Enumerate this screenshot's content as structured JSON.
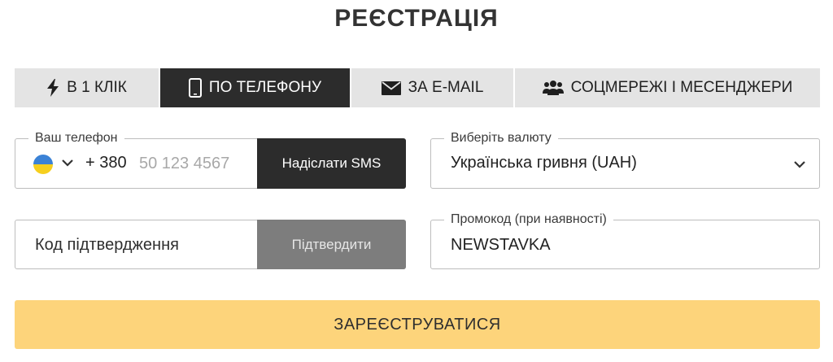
{
  "page": {
    "title": "РЕЄСТРАЦІЯ"
  },
  "tabs": [
    {
      "label": "В 1 КЛІК",
      "icon": "lightning-icon",
      "active": false
    },
    {
      "label": "ПО ТЕЛЕФОНУ",
      "icon": "smartphone-icon",
      "active": true
    },
    {
      "label": "ЗА E-MAIL",
      "icon": "envelope-icon",
      "active": false
    },
    {
      "label": "СОЦМЕРЕЖІ І МЕСЕНДЖЕРИ",
      "icon": "users-icon",
      "active": false
    }
  ],
  "phone": {
    "label": "Ваш телефон",
    "country_flag": "ukraine-flag-icon",
    "prefix": "+ 380",
    "value": "",
    "placeholder": "50 123 4567",
    "send_button": "Надіслати SMS"
  },
  "currency": {
    "label": "Виберіть валюту",
    "selected": "Українська гривня (UAH)"
  },
  "code": {
    "value": "",
    "placeholder": "Код підтвердження",
    "confirm_button": "Підтвердити"
  },
  "promo": {
    "label": "Промокод (при наявності)",
    "value": "NEWSTAVKA"
  },
  "submit": {
    "label": "ЗАРЕЄСТРУВАТИСЯ"
  },
  "colors": {
    "active_tab": "#2c2c2c",
    "inactive_tab": "#e4e4e4",
    "submit_button": "#fdd47b",
    "confirm_button_disabled": "#7d7d7d",
    "flag_blue": "#3b82d6",
    "flag_yellow": "#f6cf1e"
  }
}
